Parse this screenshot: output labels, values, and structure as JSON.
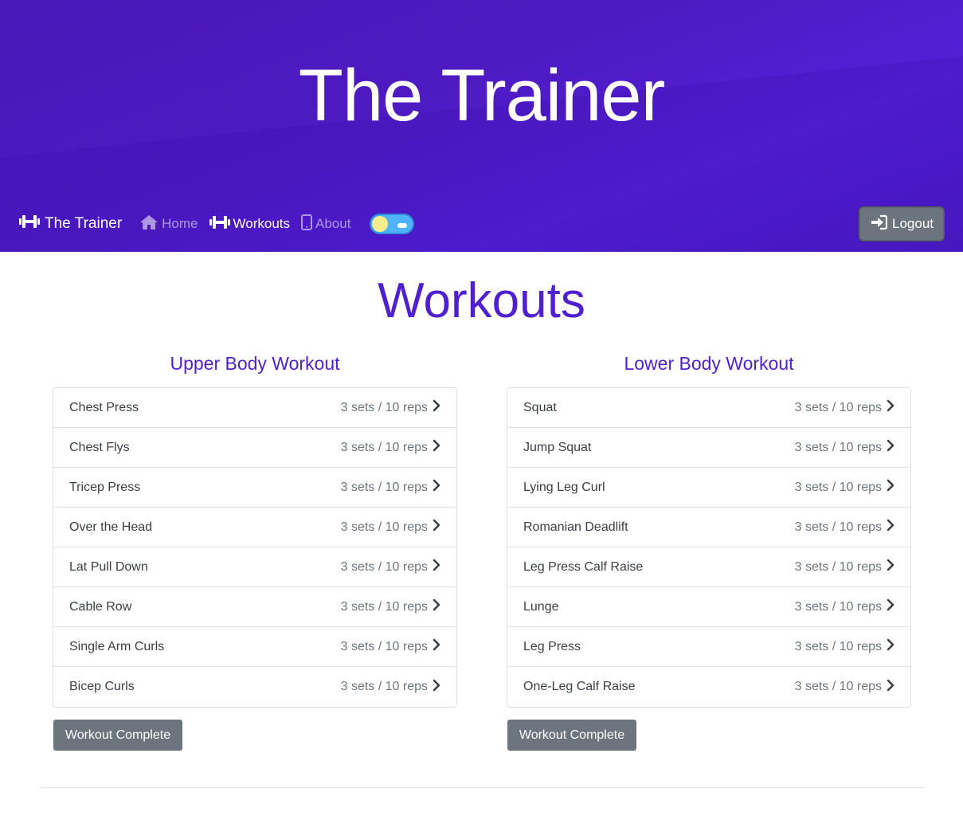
{
  "hero": {
    "title": "The Trainer"
  },
  "nav": {
    "brand": "The Trainer",
    "links": [
      {
        "label": "Home",
        "icon": "home-icon",
        "active": false
      },
      {
        "label": "Workouts",
        "icon": "dumbbell-icon",
        "active": true
      },
      {
        "label": "About",
        "icon": "mobile-icon",
        "active": false
      }
    ],
    "theme_toggle": {
      "state": "light"
    },
    "logout_label": "Logout"
  },
  "main": {
    "title": "Workouts",
    "workouts": [
      {
        "title": "Upper Body Workout",
        "exercises": [
          {
            "name": "Chest Press",
            "detail": "3 sets / 10 reps"
          },
          {
            "name": "Chest Flys",
            "detail": "3 sets / 10 reps"
          },
          {
            "name": "Tricep Press",
            "detail": "3 sets / 10 reps"
          },
          {
            "name": "Over the Head",
            "detail": "3 sets / 10 reps"
          },
          {
            "name": "Lat Pull Down",
            "detail": "3 sets / 10 reps"
          },
          {
            "name": "Cable Row",
            "detail": "3 sets / 10 reps"
          },
          {
            "name": "Single Arm Curls",
            "detail": "3 sets / 10 reps"
          },
          {
            "name": "Bicep Curls",
            "detail": "3 sets / 10 reps"
          }
        ],
        "complete_label": "Workout Complete"
      },
      {
        "title": "Lower Body Workout",
        "exercises": [
          {
            "name": "Squat",
            "detail": "3 sets / 10 reps"
          },
          {
            "name": "Jump Squat",
            "detail": "3 sets / 10 reps"
          },
          {
            "name": "Lying Leg Curl",
            "detail": "3 sets / 10 reps"
          },
          {
            "name": "Romanian Deadlift",
            "detail": "3 sets / 10 reps"
          },
          {
            "name": "Leg Press Calf Raise",
            "detail": "3 sets / 10 reps"
          },
          {
            "name": "Lunge",
            "detail": "3 sets / 10 reps"
          },
          {
            "name": "Leg Press",
            "detail": "3 sets / 10 reps"
          },
          {
            "name": "One-Leg Calf Raise",
            "detail": "3 sets / 10 reps"
          }
        ],
        "complete_label": "Workout Complete"
      }
    ]
  },
  "colors": {
    "hero_gradient": "#4e1bc4",
    "accent": "#4f1fd0",
    "button_gray": "#6c757d",
    "toggle_blue": "#4fb3ff",
    "sun_yellow": "#f7ed8d"
  }
}
